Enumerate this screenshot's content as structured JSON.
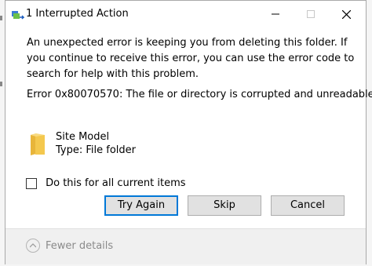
{
  "dialog": {
    "title": "1 Interrupted Action",
    "message": "An unexpected error is keeping you from deleting this folder. If you continue to receive this error, you can use the error code to search for help with this problem.",
    "error": "Error 0x80070570: The file or directory is corrupted and unreadable.",
    "item": {
      "name": "Site Model",
      "type": "Type: File folder"
    },
    "checkbox": {
      "label": "Do this for all current items",
      "checked": false
    },
    "buttons": {
      "try_again": "Try Again",
      "skip": "Skip",
      "cancel": "Cancel"
    },
    "footer": {
      "toggle_label": "Fewer details"
    },
    "colors": {
      "focus_border": "#0078d7",
      "folder_yellow": "#f4c84e",
      "footer_bg": "#f0f0f0"
    },
    "icons": {
      "title": "copy-transfer-icon",
      "item": "folder-icon",
      "toggle": "chevron-up-icon"
    }
  }
}
